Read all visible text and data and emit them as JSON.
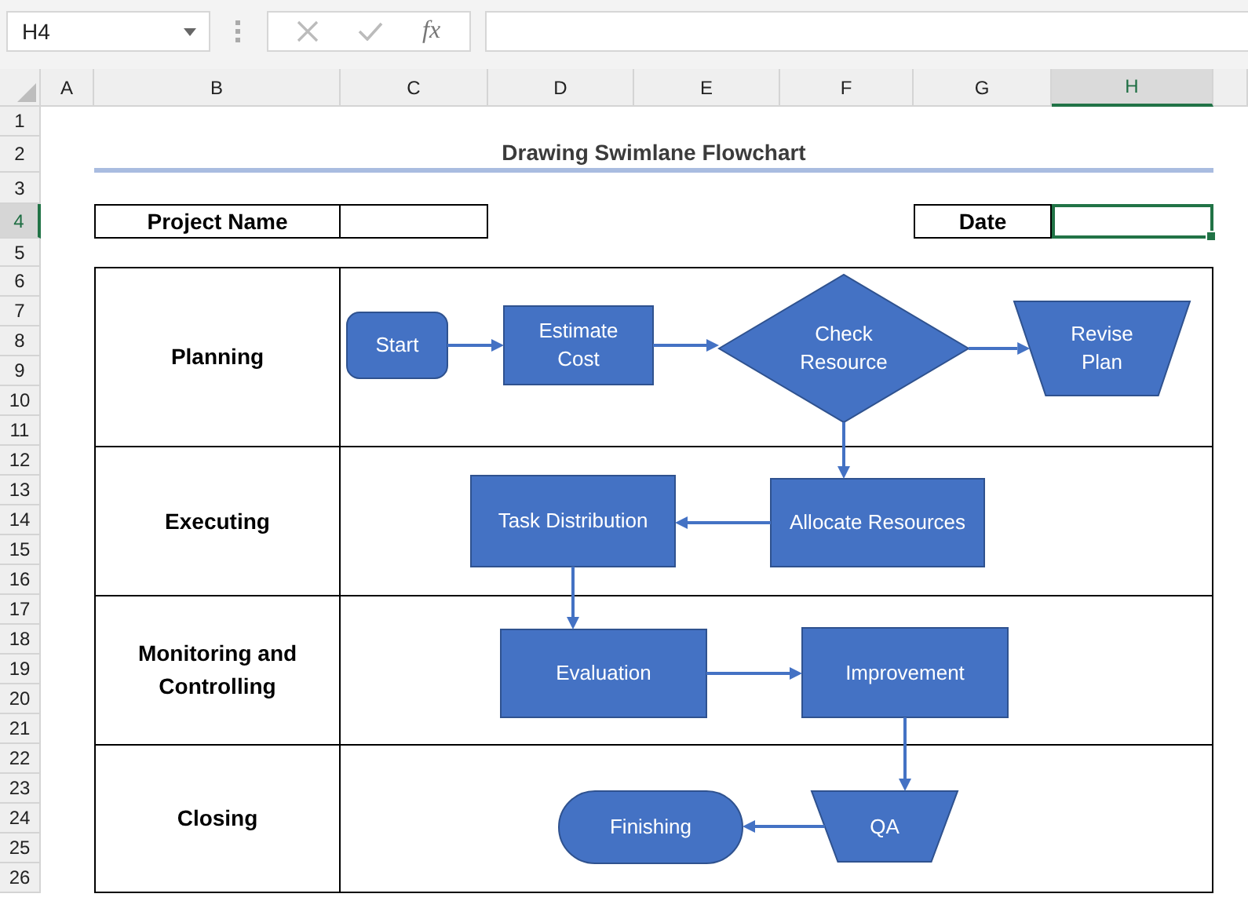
{
  "name_box": {
    "value": "H4"
  },
  "formula_bar": {
    "function_label": "fx"
  },
  "columns": [
    {
      "label": "A",
      "selected": false
    },
    {
      "label": "B",
      "selected": false
    },
    {
      "label": "C",
      "selected": false
    },
    {
      "label": "D",
      "selected": false
    },
    {
      "label": "E",
      "selected": false
    },
    {
      "label": "F",
      "selected": false
    },
    {
      "label": "G",
      "selected": false
    },
    {
      "label": "H",
      "selected": true
    }
  ],
  "rows": [
    {
      "label": "1",
      "selected": false
    },
    {
      "label": "2",
      "selected": false
    },
    {
      "label": "3",
      "selected": false
    },
    {
      "label": "4",
      "selected": true
    },
    {
      "label": "5",
      "selected": false
    },
    {
      "label": "6",
      "selected": false
    },
    {
      "label": "7",
      "selected": false
    },
    {
      "label": "8",
      "selected": false
    },
    {
      "label": "9",
      "selected": false
    },
    {
      "label": "10",
      "selected": false
    },
    {
      "label": "11",
      "selected": false
    },
    {
      "label": "12",
      "selected": false
    },
    {
      "label": "13",
      "selected": false
    },
    {
      "label": "14",
      "selected": false
    },
    {
      "label": "15",
      "selected": false
    },
    {
      "label": "16",
      "selected": false
    },
    {
      "label": "17",
      "selected": false
    },
    {
      "label": "18",
      "selected": false
    },
    {
      "label": "19",
      "selected": false
    },
    {
      "label": "20",
      "selected": false
    },
    {
      "label": "21",
      "selected": false
    },
    {
      "label": "22",
      "selected": false
    },
    {
      "label": "23",
      "selected": false
    },
    {
      "label": "24",
      "selected": false
    },
    {
      "label": "25",
      "selected": false
    },
    {
      "label": "26",
      "selected": false
    }
  ],
  "sheet": {
    "title": "Drawing Swimlane Flowchart",
    "fields": [
      {
        "label": "Project Name",
        "selected": false
      },
      {
        "label": "Date",
        "selected": true
      }
    ],
    "lanes": [
      {
        "name": "Planning"
      },
      {
        "name": "Executing"
      },
      {
        "name": "Monitoring and Controlling"
      },
      {
        "name": "Closing"
      }
    ],
    "flowchart": {
      "nodes": [
        {
          "kind": "rounded",
          "label": "Start"
        },
        {
          "kind": "process",
          "label": "Estimate Cost"
        },
        {
          "kind": "decision",
          "label": "Check Resource"
        },
        {
          "kind": "manual_operation",
          "label": "Revise Plan"
        },
        {
          "kind": "process",
          "label": "Task Distribution"
        },
        {
          "kind": "process",
          "label": "Allocate Resources"
        },
        {
          "kind": "process",
          "label": "Evaluation"
        },
        {
          "kind": "process",
          "label": "Improvement"
        },
        {
          "kind": "terminator",
          "label": "Finishing"
        },
        {
          "kind": "manual_operation",
          "label": "QA"
        }
      ]
    }
  }
}
